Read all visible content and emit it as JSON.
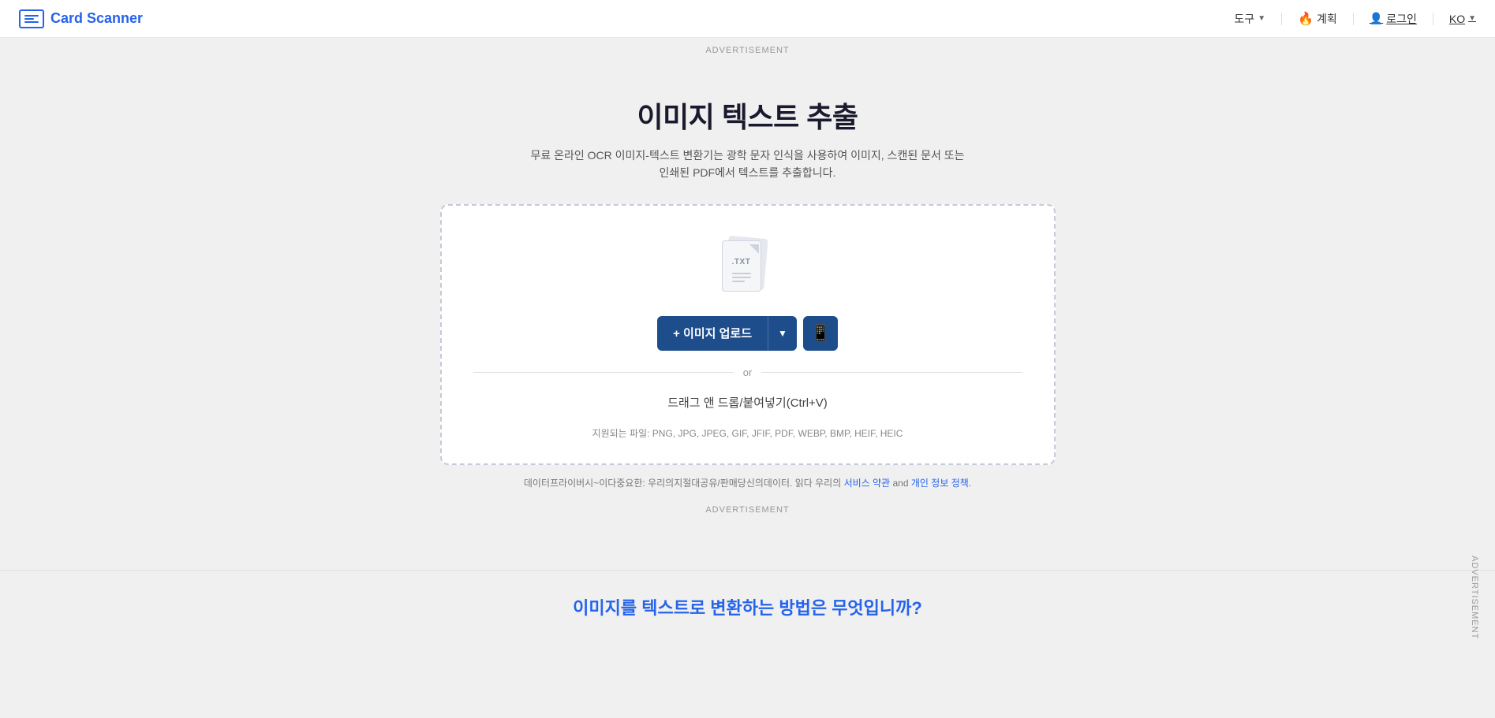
{
  "header": {
    "logo_text": "Card Scanner",
    "tools_label": "도구",
    "plan_label": "계획",
    "plan_emoji": "🔥",
    "login_label": "로그인",
    "lang_label": "KO"
  },
  "advertisement": {
    "top_label": "ADVERTISEMENT",
    "bottom_label": "ADVERTISEMENT",
    "side_label": "ADVERTISEMENT"
  },
  "main": {
    "title": "이미지 텍스트 추출",
    "subtitle": "무료 온라인 OCR 이미지-텍스트 변환기는 광학 문자 인식을 사용하여 이미지, 스캔된 문서 또는 인쇄된 PDF에서 텍스트를 추출합니다.",
    "upload_button_label": "+ 이미지 업로드",
    "or_text": "or",
    "drag_text": "드래그 앤 드롭/붙여넣기(Ctrl+V)",
    "supported_formats": "지원되는 파일: PNG, JPG, JPEG, GIF, JFIF, PDF, WEBP, BMP, HEIF, HEIC",
    "privacy_text": "데이터프라이버시~이다중요한: 우리의지절대공유/판매당신의데이터. 읽다 우리의",
    "service_terms_label": "서비스 약관",
    "and_text": "and",
    "privacy_policy_label": "개인 정보 정책.",
    "file_icon_txt": ".TXT"
  },
  "bottom": {
    "section_title": "이미지를 텍스트로 변환하는 방법은 무엇입니까?"
  }
}
